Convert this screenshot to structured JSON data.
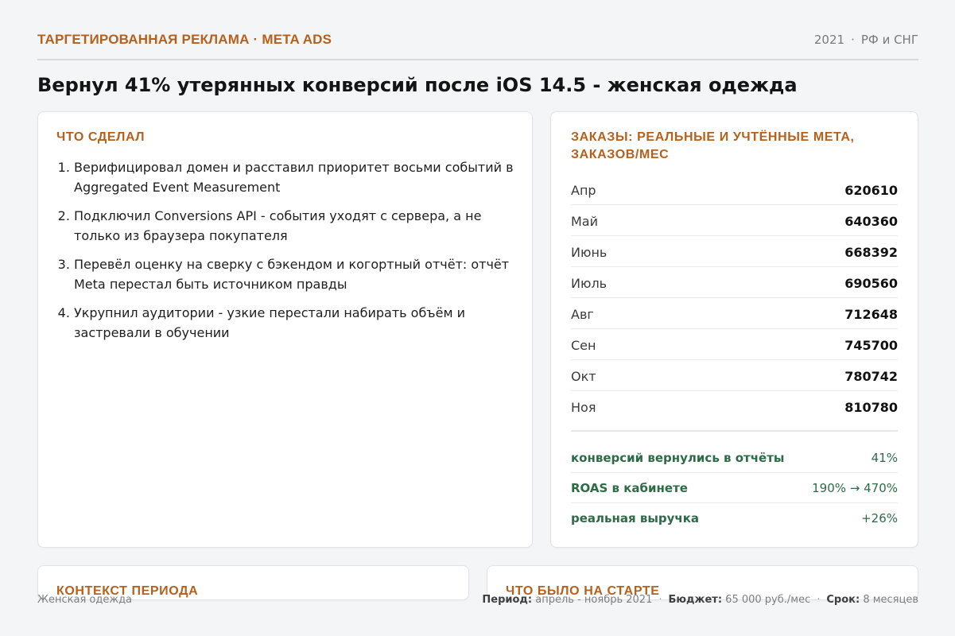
{
  "header": {
    "eyebrow": "ТАРГЕТИРОВАННАЯ РЕКЛАМА · META ADS",
    "year": "2021",
    "region": "РФ и СНГ"
  },
  "title": "Вернул 41% утерянных конверсий после iOS 14.5 - женская одежда",
  "steps": {
    "title": "ЧТО СДЕЛАЛ",
    "items": [
      "Верифицировал домен и расставил приоритет восьми событий в Aggregated Event Measurement",
      "Подключил Conversions API - события уходят с сервера, а не только из браузера покупателя",
      "Перевёл оценку на сверку с бэкендом и когортный отчёт: отчёт Meta перестал быть источником правды",
      "Укрупнил аудитории - узкие перестали набирать объём и застревали в обучении"
    ]
  },
  "orders": {
    "title": "ЗАКАЗЫ: РЕАЛЬНЫЕ И УЧТЁННЫЕ МЕТА, ЗАКАЗОВ/МЕС",
    "rows": [
      {
        "month": "Апр",
        "value": "620610"
      },
      {
        "month": "Май",
        "value": "640360"
      },
      {
        "month": "Июнь",
        "value": "668392"
      },
      {
        "month": "Июль",
        "value": "690560"
      },
      {
        "month": "Авг",
        "value": "712648"
      },
      {
        "month": "Сен",
        "value": "745700"
      },
      {
        "month": "Окт",
        "value": "780742"
      },
      {
        "month": "Ноя",
        "value": "810780"
      }
    ],
    "metrics": [
      {
        "label": "конверсий вернулись в отчёты",
        "value": "41%"
      },
      {
        "label": "ROAS в кабинете",
        "value": "190% → 470%"
      },
      {
        "label": "реальная выручка",
        "value": "+26%"
      }
    ]
  },
  "context": {
    "title": "КОНТЕКСТ ПЕРИОДА"
  },
  "start": {
    "title": "ЧТО БЫЛО НА СТАРТЕ"
  },
  "footer": {
    "category": "Женская одежда",
    "period_label": "Период:",
    "period_value": "апрель - ноябрь 2021",
    "budget_label": "Бюджет:",
    "budget_value": "65 000 руб./мес",
    "term_label": "Срок:",
    "term_value": "8 месяцев"
  },
  "colors": {
    "accent": "#b5601c",
    "positive": "#2d6b47",
    "background": "#f4f5f7"
  }
}
